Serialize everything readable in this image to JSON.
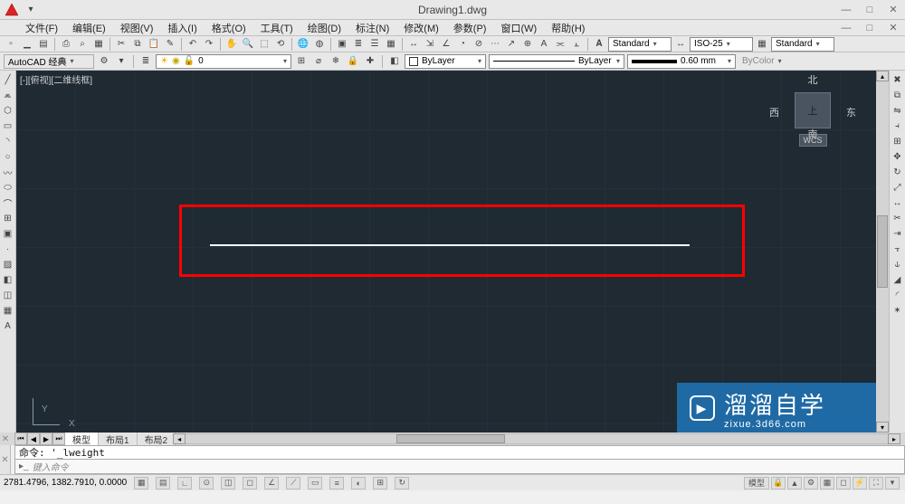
{
  "window": {
    "title": "Drawing1.dwg",
    "min": "—",
    "max": "□",
    "close": "✕"
  },
  "menu": [
    "文件(F)",
    "编辑(E)",
    "视图(V)",
    "插入(I)",
    "格式(O)",
    "工具(T)",
    "绘图(D)",
    "标注(N)",
    "修改(M)",
    "参数(P)",
    "窗口(W)",
    "帮助(H)"
  ],
  "toolbar2": {
    "workspace": "AutoCAD 经典",
    "layer": "0",
    "bylayer": "ByLayer",
    "linetype": "ByLayer",
    "lw": "0.60 mm",
    "color": "ByColor",
    "standard": "Standard",
    "iso25": "ISO-25"
  },
  "viewport": {
    "label": "[-][俯视][二维线框]",
    "cube_up": "上",
    "n": "北",
    "s": "南",
    "e": "东",
    "w": "西",
    "wcs": "WCS"
  },
  "axes": {
    "x": "X",
    "y": "Y"
  },
  "tabs": {
    "items": [
      "模型",
      "布局1",
      "布局2"
    ],
    "active_index": 0
  },
  "command": {
    "last": "命令: '_lweight",
    "prompt": "键入命令"
  },
  "status": {
    "coords": "2781.4796, 1382.7910, 0.0000",
    "right_big": "模型"
  },
  "watermark": {
    "big": "溜溜自学",
    "url": "zixue.3d66.com"
  }
}
